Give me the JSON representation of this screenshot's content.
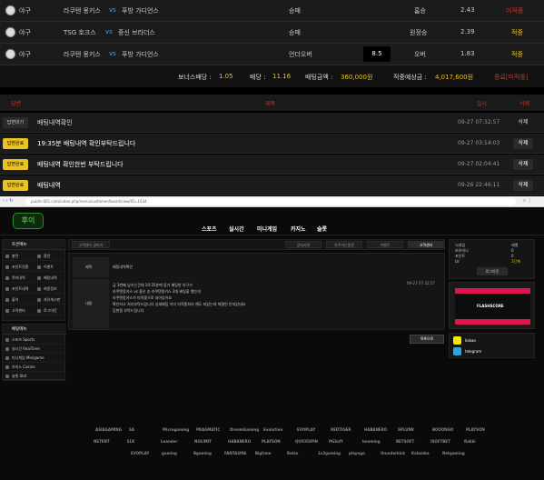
{
  "bets": [
    {
      "sport": "야구",
      "home": "라쿠텐 몽키스",
      "vs": "vs",
      "away": "푸방 가디언스",
      "market": "승패",
      "pick": "홈승",
      "odds": "2.43",
      "result": "미적중",
      "result_color": "#c0392b"
    },
    {
      "sport": "야구",
      "home": "TSG 호크스",
      "vs": "vs",
      "away": "중신 브라더스",
      "market": "승패",
      "pick": "원정승",
      "odds": "2.39",
      "result": "적중",
      "result_color": "#e8c321"
    },
    {
      "sport": "야구",
      "home": "라쿠텐 몽키스",
      "vs": "vs",
      "away": "푸방 가디언스",
      "market": "언더오버",
      "line": "8.5",
      "pick": "오버",
      "odds": "1.83",
      "result": "적중",
      "result_color": "#e8c321"
    }
  ],
  "summary": {
    "bonus_label": "보너스배당 :",
    "bonus": "1.05",
    "odds_label": "배당 :",
    "odds": "11.16",
    "amount_label": "배팅금액 :",
    "amount": "360,000원",
    "expected_label": "적중예상금 :",
    "expected": "4,017,600원",
    "status": "종료[미적중]"
  },
  "table_header": {
    "status": "답변",
    "title": "제목",
    "date": "일시",
    "delete": "삭제"
  },
  "questions": [
    {
      "badge": "답변대기",
      "title": "배팅내역확인",
      "date": "09-27 07:32:57",
      "delete": "삭제",
      "badge_bg": "#2a2a2a",
      "badge_color": "#ccc",
      "title_color": "#ddd"
    },
    {
      "badge": "답변완료",
      "title": "19:35분 배팅내역 확인부탁드립니다",
      "date": "09-27 03:14:03",
      "delete": "삭제",
      "badge_bg": "#e8c321",
      "badge_color": "#000",
      "title_color": "#fff"
    },
    {
      "badge": "답변완료",
      "title": "배팅내역 확인한번 부탁드립니다",
      "date": "09-27 02:04:41",
      "delete": "삭제",
      "badge_bg": "#e8c321",
      "badge_color": "#000",
      "title_color": "#fff"
    },
    {
      "badge": "답변완료",
      "title": "배팅내역",
      "date": "09-26 22:46:11",
      "delete": "삭제",
      "badge_bg": "#e8c321",
      "badge_color": "#000",
      "title_color": "#fff"
    }
  ],
  "browser": {
    "url": "public-001.com/index.php/menu/customer/board/view/ID=1034"
  },
  "site": {
    "logo": "후이",
    "nav": [
      "스포츠",
      "실시간",
      "미니게임",
      "카지노",
      "슬롯"
    ],
    "sidebar_top_title": "토큰메뉴",
    "sidebar_top": [
      "충전",
      "환전",
      "포인트전환",
      "이벤트",
      "쪽지내역",
      "배팅내역",
      "포인트내역",
      "회원정보",
      "출석",
      "자유게시판",
      "고객센터",
      "로그아웃"
    ],
    "sidebar_bottom_title": "베팅메뉴",
    "sidebar_bottom": [
      "스포츠 Sports",
      "실시간 RealTime",
      "미니게임 Minigame",
      "카지노 Casino",
      "슬롯 Slot"
    ],
    "board_tab": "고객센터 글보기",
    "board_tabs": [
      "공지사항",
      "자주하는질문",
      "이벤트",
      "고객센터"
    ],
    "post_title_label": "제목",
    "post_title": "배팅내역확인",
    "post_date": "09-27 07:32:57",
    "post_body_label": "내용",
    "post_body": [
      "금 3번째 남기는건데 19:35분에 동기 배팅한 야구가",
      "라쿠텐몽키스 vs 중신 승 라쿠텐몽키스 2대 배팅을 했는데",
      "라쿠텐몽키스가 미적중으로 되어있어요",
      "확인하고 처리부탁드립니다 상세배팅 이미 미적중처리 해도 되었는데 체결된 안되었네요",
      "답변좀 부탁드립니다"
    ],
    "list_button": "목록으로",
    "user": [
      [
        "닉네임",
        "레벨"
      ],
      [
        "보유머니",
        "0"
      ],
      [
        "포인트",
        "0"
      ],
      [
        "LV",
        "1단계"
      ]
    ],
    "logout": "로그아웃",
    "flashscore": "FLASHSCORE",
    "contacts": [
      {
        "icon": "kakao-icon",
        "label": "kakao"
      },
      {
        "icon": "telegram-icon",
        "label": "telegram"
      }
    ],
    "partners": [
      "ASIAGAMING",
      "SA",
      "Microgaming",
      "PRAGMATIC",
      "DreamGaming",
      "Evolution",
      "EVOPLAY",
      "REDTIGER",
      "HABANERO",
      "SPLUNK",
      "BOOONGO",
      "PLAYSON",
      "NETENT",
      "ELK",
      "Leander",
      "NOLIMIT",
      "HABANERO",
      "PLAYSON",
      "QUICKSPIN",
      "PGSoft",
      "booming",
      "BETSOFT",
      "ISOFTBET",
      "Rakki",
      "EVOPLAY",
      "gaming",
      "Bgaming",
      "FANTASMA",
      "Bigtime",
      "Relax",
      "1x2gaming",
      "playngo",
      "thunderkick",
      "Kalamba",
      "Netgaming"
    ]
  }
}
